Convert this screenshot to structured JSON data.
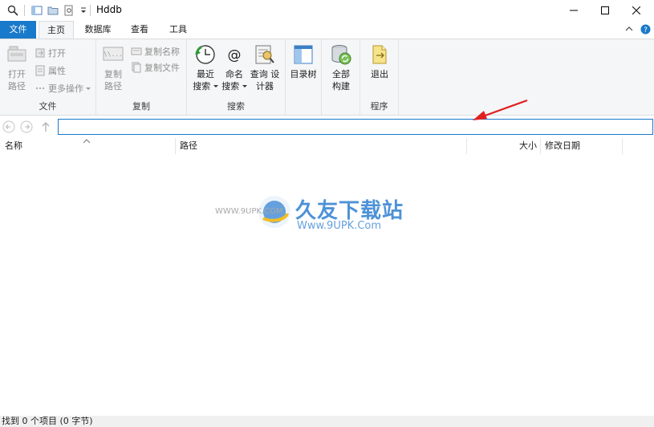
{
  "window": {
    "title": "Hddb",
    "minimize_label": "—",
    "maximize_label": "☐",
    "close_label": "✕"
  },
  "tabs": {
    "file": "文件",
    "home": "主页",
    "database": "数据库",
    "view": "查看",
    "tools": "工具"
  },
  "ribbon": {
    "groups": {
      "file": "文件",
      "copy": "复制",
      "search": "搜索",
      "program": "程序"
    },
    "file": {
      "open_path": "打开\n路径",
      "open": "打开",
      "properties": "属性",
      "more_actions": "更多操作"
    },
    "copy": {
      "copy_path": "复制\n路径",
      "copy_name": "复制名称",
      "copy_file": "复制文件"
    },
    "search": {
      "recent": "最近\n搜索",
      "by_name": "命名\n搜索",
      "query_designer": "查询 设\n计器"
    },
    "tree": "目录树",
    "rebuild": "全部\n构建",
    "exit": "退出"
  },
  "address": {
    "value": ""
  },
  "columns": {
    "name": "名称",
    "path": "路径",
    "size": "大小",
    "modified": "修改日期"
  },
  "status": {
    "text": "找到 0 个项目 (0 字节)"
  },
  "watermark": {
    "brand": "久友下载站",
    "url_left": "WWW.9UPK.COM",
    "url_right": "Www.9UPK.Com"
  },
  "colors": {
    "accent": "#1979ca",
    "arrow": "#e02020"
  }
}
